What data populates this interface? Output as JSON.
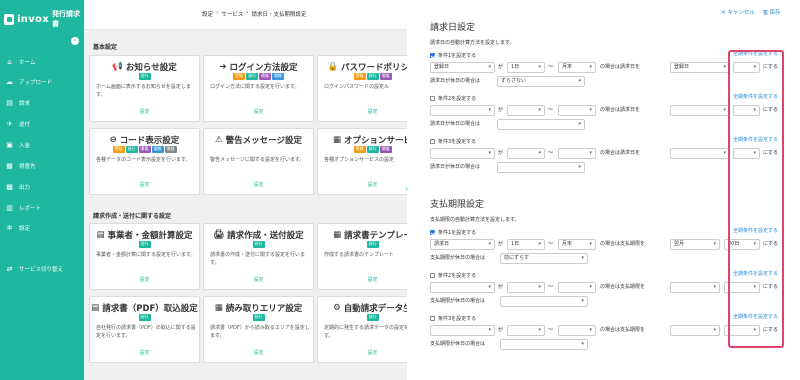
{
  "app": {
    "brand": "invox",
    "subtitle": "発行請求書"
  },
  "breadcrumb": [
    "設定",
    "›",
    "サービス",
    "›",
    "請求日・支払期限設定"
  ],
  "sidebar": {
    "items": [
      {
        "label": "ホーム",
        "icon": "home-icon",
        "glyph": "⌂"
      },
      {
        "label": "アップロード",
        "icon": "upload-icon",
        "glyph": "☁"
      },
      {
        "label": "請求",
        "icon": "invoice-icon",
        "glyph": "▤"
      },
      {
        "label": "送付",
        "icon": "send-icon",
        "glyph": "✈"
      },
      {
        "label": "入金",
        "icon": "payment-icon",
        "glyph": "▣"
      },
      {
        "label": "得意先",
        "icon": "customer-icon",
        "glyph": "▦"
      },
      {
        "label": "出力",
        "icon": "output-icon",
        "glyph": "▩"
      },
      {
        "label": "レポート",
        "icon": "report-icon",
        "glyph": "▥"
      },
      {
        "label": "設定",
        "icon": "gear-icon",
        "glyph": "✲"
      }
    ],
    "switch_service": {
      "label": "サービス切り替え",
      "glyph": "⇄"
    }
  },
  "sections": {
    "basic": "基本設定",
    "invoice": "請求作成・送付に関する設定"
  },
  "cards": [
    {
      "title": "お知らせ設定",
      "glyph": "📢",
      "badges": [
        {
          "t": "発行",
          "c": "#1fb79f"
        }
      ],
      "desc": "ホーム画面に表示するお知らせを設定します。",
      "link": "設定"
    },
    {
      "title": "ログイン方法設定",
      "glyph": "➜",
      "badges": [
        {
          "t": "受取",
          "c": "#f39c12"
        },
        {
          "t": "発行",
          "c": "#1fb79f"
        },
        {
          "t": "債権",
          "c": "#9b59b6"
        },
        {
          "t": "電帳",
          "c": "#3498db"
        }
      ],
      "desc": "ログイン方法に関する設定を行います。",
      "link": "設定"
    },
    {
      "title": "パスワードポリシー",
      "glyph": "🔒",
      "badges": [
        {
          "t": "受取",
          "c": "#f39c12"
        },
        {
          "t": "発行",
          "c": "#1fb79f"
        },
        {
          "t": "債権",
          "c": "#9b59b6"
        }
      ],
      "desc": "ログインパスワードの設定ル",
      "link": "設定"
    },
    {
      "title": "コード表示設定",
      "glyph": "⊖",
      "badges": [
        {
          "t": "受取",
          "c": "#f39c12"
        },
        {
          "t": "発行",
          "c": "#1fb79f"
        },
        {
          "t": "債権",
          "c": "#9b59b6"
        },
        {
          "t": "電帳",
          "c": "#3498db"
        },
        {
          "t": "債務",
          "c": "#7f8c8d"
        }
      ],
      "desc": "各種データのコード表示設定を行います。",
      "link": "設定"
    },
    {
      "title": "警告メッセージ設定",
      "glyph": "⚠",
      "badges": [],
      "desc": "警告メッセージに関する設定を行います。",
      "link": "設定"
    },
    {
      "title": "オプションサービ",
      "glyph": "▦",
      "badges": [
        {
          "t": "受取",
          "c": "#f39c12"
        },
        {
          "t": "発行",
          "c": "#1fb79f"
        },
        {
          "t": "債権",
          "c": "#9b59b6"
        }
      ],
      "desc": "各種オプションサービスの設定",
      "link": "設定"
    },
    {
      "title": "事業者・金額計算設定",
      "glyph": "▤",
      "badges": [
        {
          "t": "発行",
          "c": "#1fb79f"
        }
      ],
      "desc": "事業者・金額計算に関する設定を行います。",
      "link": "設定"
    },
    {
      "title": "請求作成・送付設定",
      "glyph": "🖨",
      "badges": [
        {
          "t": "発行",
          "c": "#1fb79f"
        }
      ],
      "desc": "請求書の作成・送付に関する設定を行います。",
      "link": "設定"
    },
    {
      "title": "請求書テンプレー",
      "glyph": "▦",
      "badges": [
        {
          "t": "発行",
          "c": "#1fb79f"
        }
      ],
      "desc": "作成する請求書のテンプレート",
      "link": "設定"
    },
    {
      "title": "請求書（PDF）取込設定",
      "glyph": "▤",
      "badges": [
        {
          "t": "発行",
          "c": "#1fb79f"
        }
      ],
      "desc": "自社発行の請求書（PDF）の取込に関する設定を行います。",
      "link": "設定"
    },
    {
      "title": "読み取りエリア設定",
      "glyph": "▦",
      "badges": [
        {
          "t": "発行",
          "c": "#1fb79f"
        }
      ],
      "desc": "請求書（PDF）から読み取るエリアを設定します。",
      "link": "設定"
    },
    {
      "title": "自動請求データ生",
      "glyph": "⚙",
      "badges": [
        {
          "t": "発行",
          "c": "#1fb79f"
        }
      ],
      "desc": "定期的に発生する請求データの設定を行います。",
      "link": "設定"
    }
  ],
  "actions": {
    "cancel": "✕ キャンセル",
    "save": "🖫 保存"
  },
  "billing": {
    "title": "請求日設定",
    "desc": "請求日の自動計算方法を設定します。",
    "cond1": "条件1を設定する",
    "cond2": "条件2を設定する",
    "cond3": "条件3を設定する",
    "s1": "登録日",
    "s2": "1日",
    "s3": "月末",
    "s4": "登録日",
    "s5": "ずらさない",
    "ga": "が",
    "tilde": "〜",
    "if_label": "の場合は請求日を",
    "suffix": "にする",
    "holiday": "請求日が休日の場合は",
    "all": "全期条件を設定する"
  },
  "due": {
    "title": "支払期限設定",
    "desc": "支払期限の自動計算方法を設定します。",
    "cond1": "条件1を設定する",
    "cond2": "条件2を設定する",
    "cond3": "条件3を設定する",
    "s1": "請求日",
    "s2": "1日",
    "s3": "月末",
    "s4": "翌月",
    "s5": "20日",
    "s6": "前にずらす",
    "ga": "が",
    "tilde": "〜",
    "if_label": "の場合は支払期限を",
    "suffix": "にする",
    "holiday": "支払期限が休日の場合は",
    "all": "全期条件を設定する"
  }
}
